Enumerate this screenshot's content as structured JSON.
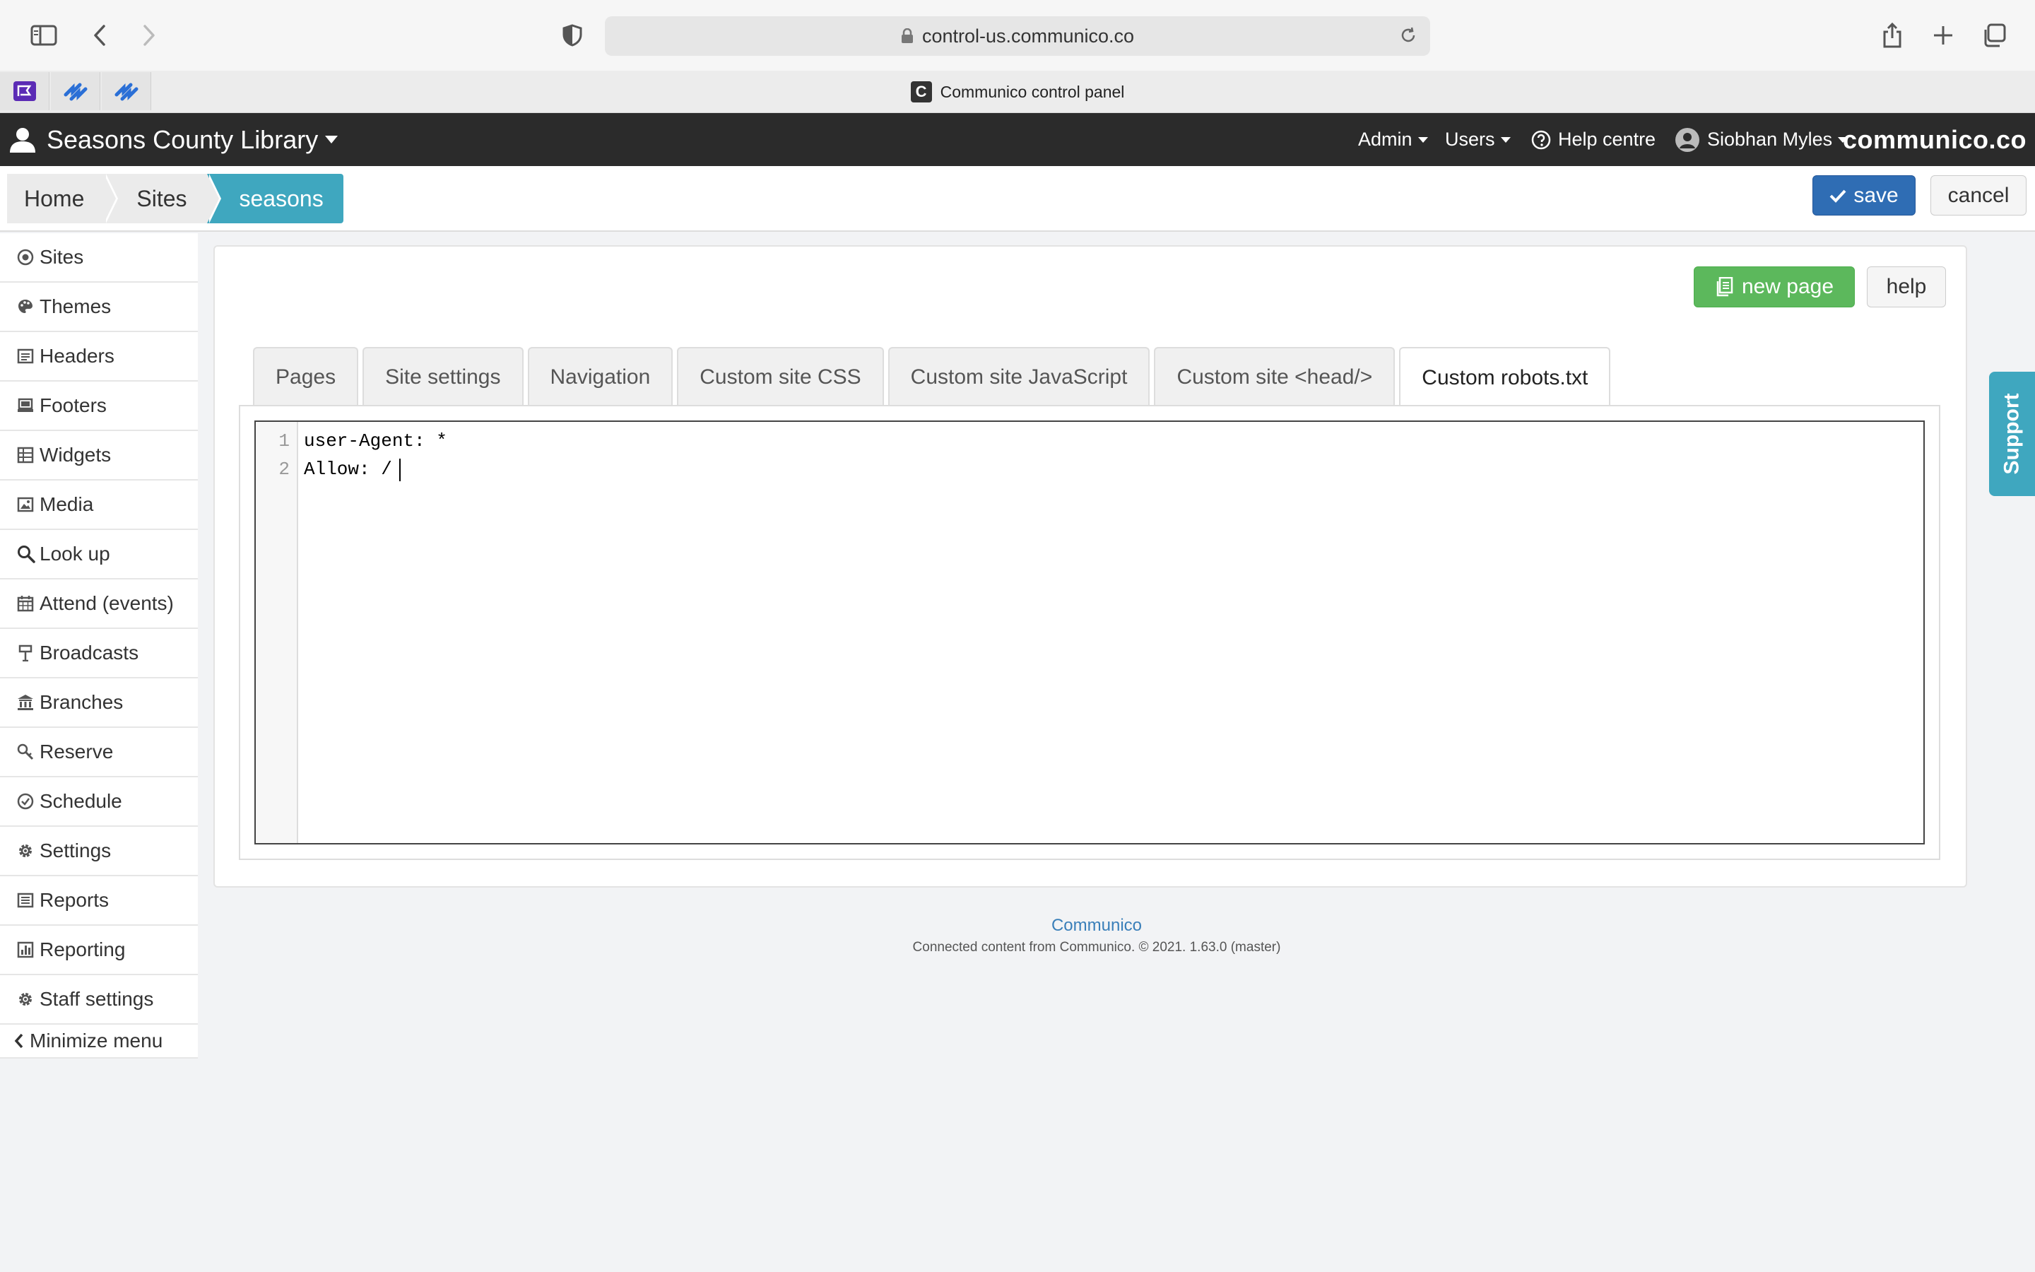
{
  "browser": {
    "url": "control-us.communico.co",
    "tab_title": "Communico control panel"
  },
  "header": {
    "site_name": "Seasons County Library",
    "admin_label": "Admin",
    "users_label": "Users",
    "help_label": "Help centre",
    "user_name": "Siobhan Myles",
    "brand": "communico.co"
  },
  "breadcrumb": {
    "items": [
      "Home",
      "Sites",
      "seasons"
    ]
  },
  "toolbar": {
    "save_label": "save",
    "cancel_label": "cancel"
  },
  "sidebar": {
    "items": [
      {
        "label": "Sites",
        "icon": "target-icon"
      },
      {
        "label": "Themes",
        "icon": "palette-icon"
      },
      {
        "label": "Headers",
        "icon": "document-icon"
      },
      {
        "label": "Footers",
        "icon": "laptop-icon"
      },
      {
        "label": "Widgets",
        "icon": "grid-icon"
      },
      {
        "label": "Media",
        "icon": "image-icon"
      },
      {
        "label": "Look up",
        "icon": "search-icon"
      },
      {
        "label": "Attend (events)",
        "icon": "calendar-icon"
      },
      {
        "label": "Broadcasts",
        "icon": "signpost-icon"
      },
      {
        "label": "Branches",
        "icon": "building-icon"
      },
      {
        "label": "Reserve",
        "icon": "key-search-icon"
      },
      {
        "label": "Schedule",
        "icon": "check-circle-icon"
      },
      {
        "label": "Settings",
        "icon": "gear-icon"
      },
      {
        "label": "Reports",
        "icon": "report-icon"
      },
      {
        "label": "Reporting",
        "icon": "bar-chart-icon"
      },
      {
        "label": "Staff settings",
        "icon": "gear-icon"
      }
    ],
    "minimize_label": "Minimize menu"
  },
  "panel": {
    "new_page_label": "new page",
    "help_label": "help",
    "tabs": [
      {
        "label": "Pages"
      },
      {
        "label": "Site settings"
      },
      {
        "label": "Navigation"
      },
      {
        "label": "Custom site CSS"
      },
      {
        "label": "Custom site JavaScript"
      },
      {
        "label": "Custom site <head/>"
      },
      {
        "label": "Custom robots.txt"
      }
    ],
    "active_tab": "Custom robots.txt",
    "editor": {
      "line_numbers": [
        "1",
        "2"
      ],
      "lines": [
        "user-Agent: *",
        "Allow: /"
      ]
    }
  },
  "support_label": "Support",
  "footer": {
    "link": "Communico",
    "copy": "Connected content from Communico. © 2021. 1.63.0 (master)"
  },
  "colors": {
    "header_bg": "#2b2b2b",
    "accent_teal": "#3fa7bf",
    "save_blue": "#2f6db4",
    "new_page_green": "#5cb85c"
  }
}
